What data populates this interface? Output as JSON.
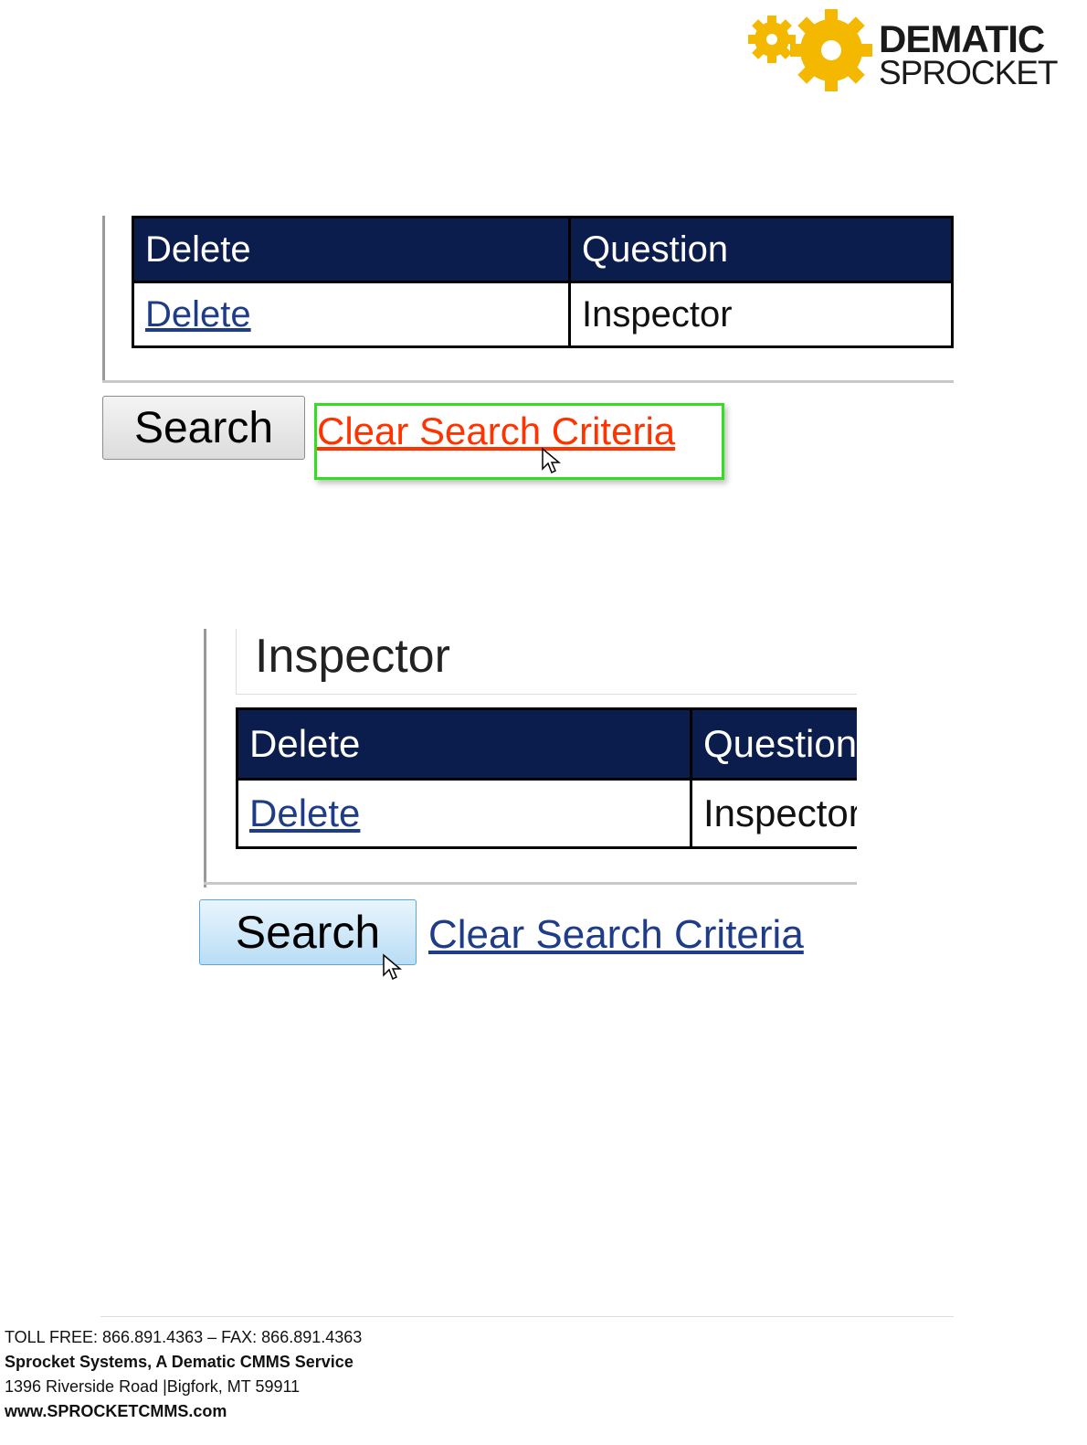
{
  "brand": {
    "line1": "DEMATIC",
    "line2": "SPROCKET",
    "gear_color": "#f5b800"
  },
  "shot1": {
    "table": {
      "headers": [
        "Delete",
        "Question"
      ],
      "row": {
        "delete_link": "Delete",
        "question": "Inspector"
      }
    },
    "search_button": "Search",
    "clear_link": "Clear Search Criteria",
    "highlight_color": "#33dd22",
    "clear_link_color": "#ff3300"
  },
  "shot2": {
    "section_title": "Inspector",
    "table": {
      "headers": [
        "Delete",
        "Question"
      ],
      "row": {
        "delete_link": "Delete",
        "question": "Inspector"
      }
    },
    "search_button": "Search",
    "clear_link": "Clear Search Criteria"
  },
  "footer": {
    "line1": "TOLL FREE: 866.891.4363 – FAX: 866.891.4363",
    "line2": "Sprocket Systems, A Dematic CMMS Service",
    "line3": "1396 Riverside  Road |Bigfork, MT 59911",
    "line4": "www.SPROCKETCMMS.com"
  },
  "colors": {
    "header_bg": "#0b1d4d",
    "link": "#1f3c88"
  }
}
